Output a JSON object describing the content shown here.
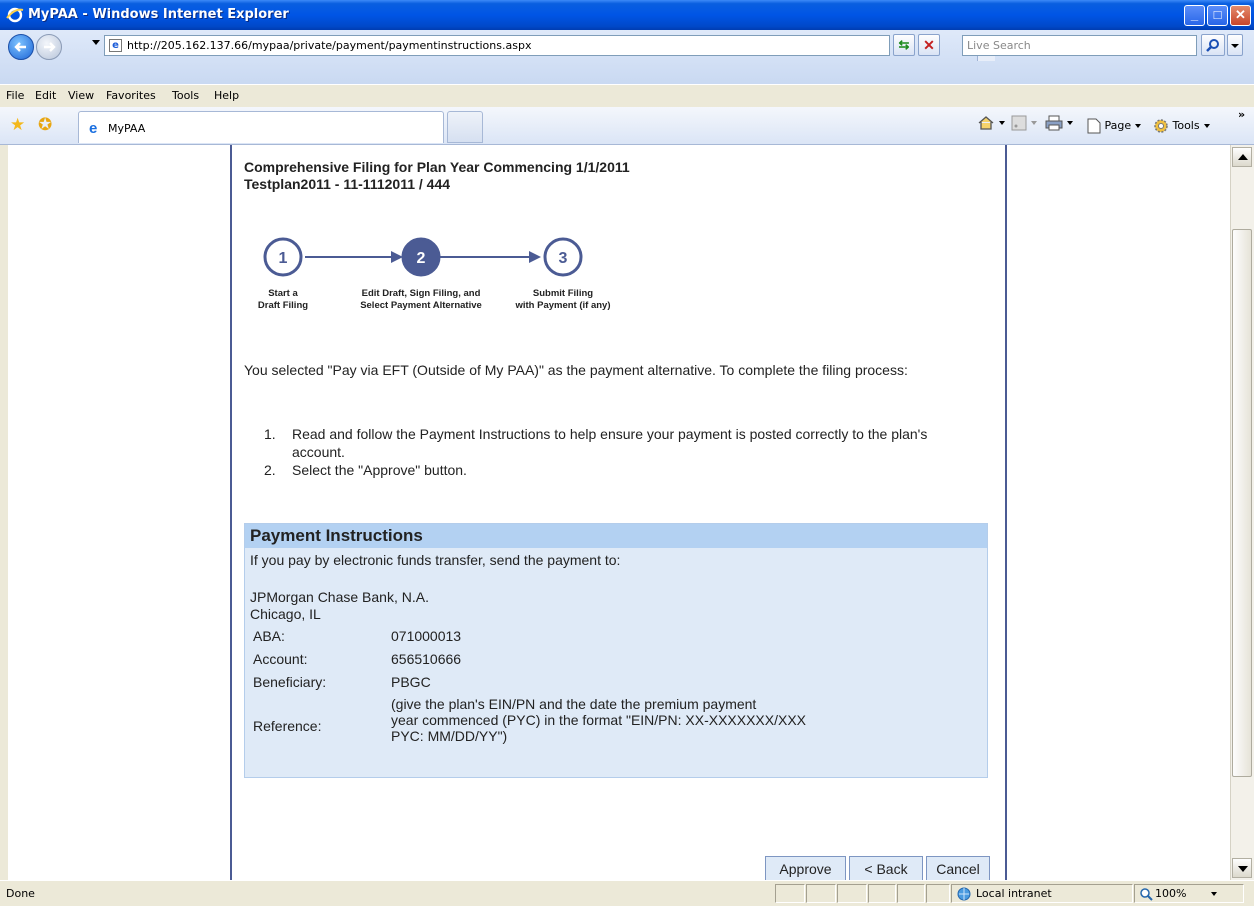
{
  "window": {
    "title": "MyPAA - Windows Internet Explorer"
  },
  "address_bar": {
    "url": "http://205.162.137.66/mypaa/private/payment/paymentinstructions.aspx"
  },
  "search": {
    "placeholder": "Live Search"
  },
  "menu": [
    "File",
    "Edit",
    "View",
    "Favorites",
    "Tools",
    "Help"
  ],
  "tab": {
    "label": "MyPAA"
  },
  "command_bar": {
    "page_label": "Page",
    "tools_label": "Tools"
  },
  "page": {
    "heading_line1": "Comprehensive Filing for Plan Year Commencing 1/1/2011",
    "heading_line2": "Testplan2011 - 11-1112011 / 444",
    "steps": [
      {
        "number": "1",
        "label_line1": "Start a",
        "label_line2": "Draft Filing",
        "active": false
      },
      {
        "number": "2",
        "label_line1": "Edit Draft, Sign Filing, and",
        "label_line2": "Select Payment Alternative",
        "active": true
      },
      {
        "number": "3",
        "label_line1": "Submit Filing",
        "label_line2": "with Payment (if any)",
        "active": false
      }
    ],
    "intro": "You selected \"Pay via EFT (Outside of My PAA)\" as the payment alternative. To complete the filing process:",
    "instructions": [
      {
        "num": "1.",
        "text": "Read and follow the Payment Instructions to help ensure your payment is posted correctly to the plan's account."
      },
      {
        "num": "2.",
        "text": "Select the \"Approve\" button."
      }
    ],
    "payment": {
      "title": "Payment Instructions",
      "intro": "If you pay by electronic funds transfer, send the payment to:",
      "bank_name": "JPMorgan Chase Bank, N.A.",
      "bank_city": "Chicago, IL",
      "aba_label": "ABA:",
      "aba_value": "071000013",
      "account_label": "Account:",
      "account_value": "656510666",
      "beneficiary_label": "Beneficiary:",
      "beneficiary_value": "PBGC",
      "reference_label": "Reference:",
      "reference_line1": "(give the plan's EIN/PN and the date the premium payment",
      "reference_line2": "year commenced (PYC) in the format \"EIN/PN: XX-XXXXXXX/XXX",
      "reference_line3": "PYC: MM/DD/YY\")"
    },
    "buttons": {
      "approve": "Approve",
      "back": "< Back",
      "cancel": "Cancel"
    }
  },
  "status": {
    "text": "Done",
    "zone": "Local intranet",
    "zoom": "100%"
  },
  "colors": {
    "step_active": "#4b5b94",
    "step_border": "#4b5b94",
    "payment_header": "#b3d1f2",
    "payment_body": "#dfeaf7"
  }
}
